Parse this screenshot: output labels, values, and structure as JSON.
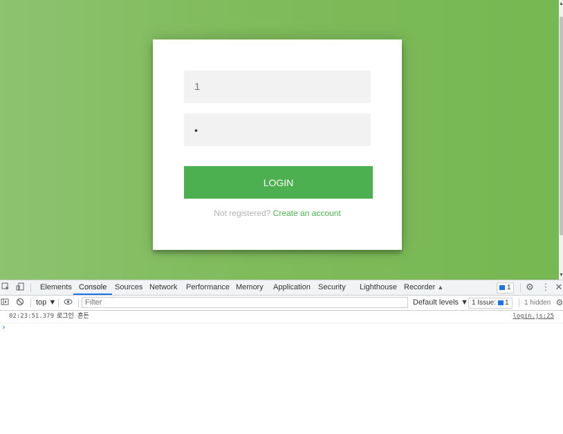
{
  "login_form": {
    "username_value": "1",
    "password_value": "•",
    "login_label": "LOGIN",
    "register_prompt": "Not registered?",
    "register_link": "Create an account"
  },
  "devtools": {
    "tabs": [
      "Elements",
      "Console",
      "Sources",
      "Network",
      "Performance",
      "Memory",
      "Application",
      "Security",
      "Lighthouse",
      "Recorder"
    ],
    "active_tab": "Console",
    "messages_badge_count": "1",
    "context": "top ▼",
    "filter_placeholder": "Filter",
    "levels": "Default levels ▼",
    "issues_label": "1 Issue:",
    "issues_count": "1",
    "hidden": "1 hidden",
    "log": {
      "time": "02:23:51.379",
      "message": "로그인 흔든",
      "source": "login.js:25"
    },
    "prompt_symbol": "›"
  },
  "colors": {
    "page_bg": "#76b852",
    "accent": "#4caf50",
    "devtools_accent": "#1a73e8"
  }
}
